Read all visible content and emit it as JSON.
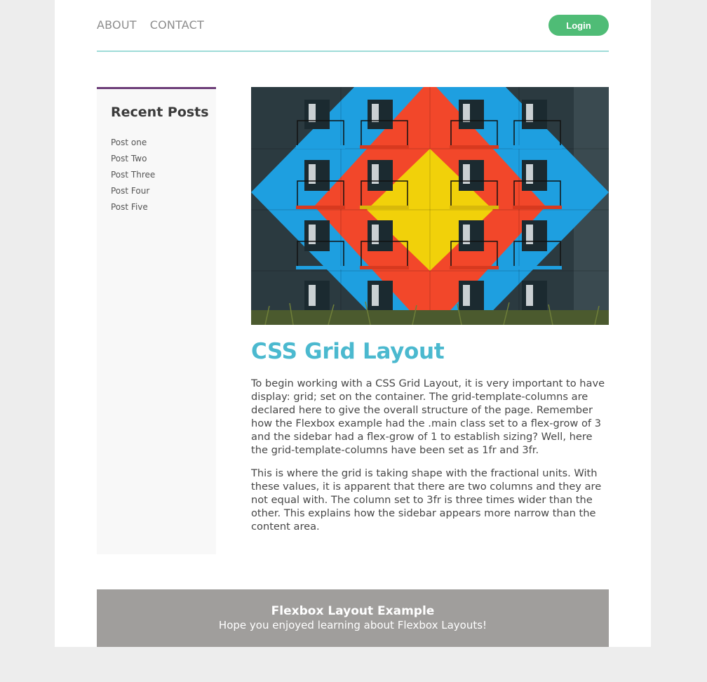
{
  "nav": {
    "items": [
      {
        "label": "ABOUT"
      },
      {
        "label": "CONTACT"
      }
    ],
    "login_label": "Login"
  },
  "sidebar": {
    "heading": "Recent Posts",
    "posts": [
      {
        "label": "Post one"
      },
      {
        "label": "Post Two"
      },
      {
        "label": "Post Three"
      },
      {
        "label": "Post Four"
      },
      {
        "label": "Post Five"
      }
    ]
  },
  "main": {
    "image_alt": "Colorful apartment building facade with balconies",
    "title": "CSS Grid Layout",
    "paragraphs": [
      "To begin working with a CSS Grid Layout, it is very important to have display: grid; set on the container. The grid-template-columns are declared here to give the overall structure of the page. Remember how the Flexbox example had the .main class set to a flex-grow of 3 and the sidebar had a flex-grow of 1 to establish sizing? Well, here the grid-template-columns have been set as 1fr and 3fr.",
      "This is where the grid is taking shape with the fractional units. With these values, it is apparent that there are two columns and they are not equal with. The column set to 3fr is three times wider than the other. This explains how the sidebar appears more narrow than the content area."
    ]
  },
  "footer": {
    "title": "Flexbox Layout Example",
    "subtitle": "Hope you enjoyed learning about Flexbox Layouts!"
  },
  "colors": {
    "accent_title": "#4bb9cf",
    "login_button": "#4fbc76",
    "sidebar_border": "#6c3d78",
    "header_rule": "#9fdcd8",
    "footer_bg": "#a09e9c"
  }
}
